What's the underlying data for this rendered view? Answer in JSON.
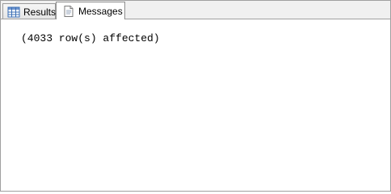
{
  "tabs": [
    {
      "label": "Results",
      "icon": "grid-icon",
      "active": false
    },
    {
      "label": "Messages",
      "icon": "message-document-icon",
      "active": true
    }
  ],
  "messages": {
    "text": "(4033 row(s) affected)"
  },
  "colors": {
    "tabstrip_background": "#f0f0f0",
    "border": "#a0a0a0",
    "content_background": "#ffffff",
    "text": "#000000",
    "grid_icon_blue": "#3b6fb6"
  }
}
